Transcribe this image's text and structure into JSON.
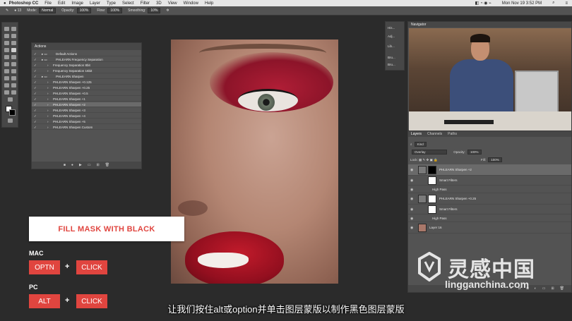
{
  "menubar": {
    "app": "Photoshop CC",
    "items": [
      "File",
      "Edit",
      "Image",
      "Layer",
      "Type",
      "Select",
      "Filter",
      "3D",
      "View",
      "Window",
      "Help"
    ],
    "datetime": "Mon Nov 19  3:52 PM"
  },
  "optionsbar": {
    "mode_label": "Mode:",
    "mode_value": "Normal",
    "opacity_label": "Opacity:",
    "opacity_value": "100%",
    "flow_label": "Flow:",
    "flow_value": "100%",
    "smoothing_label": "Smoothing:",
    "smoothing_value": "10%"
  },
  "actions_panel": {
    "title": "Actions",
    "rows": [
      {
        "label": "Default Actions",
        "indent": 0
      },
      {
        "label": "PHLEARN Frequency Separation",
        "indent": 0
      },
      {
        "label": "Frequency Separation 8bit",
        "indent": 1
      },
      {
        "label": "Frequency Separation 16bit",
        "indent": 1
      },
      {
        "label": "PHLEARN Sharpen",
        "indent": 0
      },
      {
        "label": "PHLEARN Sharpen +0.125",
        "indent": 1
      },
      {
        "label": "PHLEARN Sharpen +0.25",
        "indent": 1
      },
      {
        "label": "PHLEARN Sharpen +0.5",
        "indent": 1
      },
      {
        "label": "PHLEARN Sharpen +1",
        "indent": 1
      },
      {
        "label": "PHLEARN Sharpen +2",
        "indent": 1,
        "selected": true
      },
      {
        "label": "PHLEARN Sharpen +3",
        "indent": 1
      },
      {
        "label": "PHLEARN Sharpen +4",
        "indent": 1
      },
      {
        "label": "PHLEARN Sharpen +5",
        "indent": 1
      },
      {
        "label": "PHLEARN Sharpen Custom",
        "indent": 1
      }
    ]
  },
  "mid_strip": {
    "items": [
      "His...",
      "Adj...",
      "Lib...",
      "Bru...",
      "Bru..."
    ]
  },
  "navigator": {
    "title": "Navigator"
  },
  "layers_panel": {
    "tabs": [
      "Layers",
      "Channels",
      "Paths"
    ],
    "kind_label": "Kind",
    "blend_mode": "Overlay",
    "opacity_label": "Opacity:",
    "opacity_value": "100%",
    "lock_label": "Lock:",
    "fill_label": "Fill:",
    "fill_value": "100%",
    "rows": [
      {
        "label": "PHLEARN Sharpen +2",
        "type": "layer",
        "selected": true
      },
      {
        "label": "Smart Filters",
        "type": "filter"
      },
      {
        "label": "High Pass",
        "type": "subfilter"
      },
      {
        "label": "PHLEARN Sharpen +0.25",
        "type": "layer"
      },
      {
        "label": "Smart Filters",
        "type": "filter"
      },
      {
        "label": "High Pass",
        "type": "subfilter"
      },
      {
        "label": "Layer 16",
        "type": "photo"
      }
    ]
  },
  "overlay": {
    "banner": "FILL MASK WITH BLACK",
    "mac_label": "MAC",
    "mac_key1": "OPTN",
    "mac_key2": "CLICK",
    "pc_label": "PC",
    "pc_key1": "ALT",
    "pc_key2": "CLICK",
    "plus": "+"
  },
  "subtitle": "让我们按住alt或option并单击图层蒙版以制作黑色图层蒙版",
  "watermark": {
    "cn": "灵感中国",
    "url": "lingganchina.com"
  },
  "colors": {
    "accent": "#e0453f",
    "panel": "#535353",
    "bg": "#2b2b2b"
  }
}
